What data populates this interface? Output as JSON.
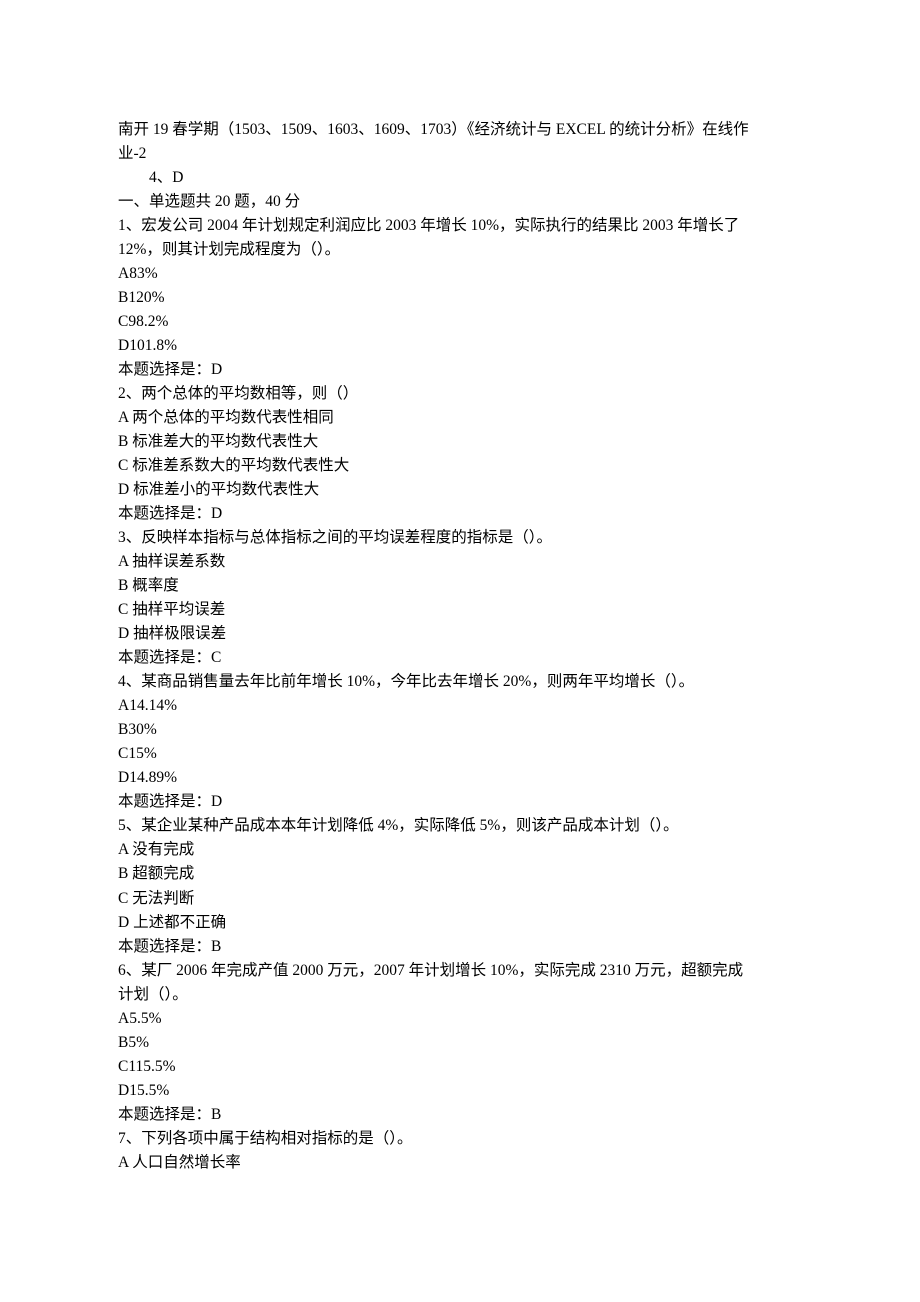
{
  "header": {
    "title_line1": "南开 19 春学期（1503、1509、1603、1609、1703）《经济统计与 EXCEL 的统计分析》在线作",
    "title_line2": "业-2",
    "note": "4、D"
  },
  "section1": {
    "heading": "一、单选题共 20 题，40 分"
  },
  "q1": {
    "stem_line1": "1、宏发公司 2004 年计划规定利润应比 2003 年增长 10%，实际执行的结果比 2003 年增长了",
    "stem_line2": "12%，则其计划完成程度为（）。",
    "optA": "A83%",
    "optB": "B120%",
    "optC": "C98.2%",
    "optD": "D101.8%",
    "answer": "本题选择是：D"
  },
  "q2": {
    "stem": "2、两个总体的平均数相等，则（）",
    "optA": "A 两个总体的平均数代表性相同",
    "optB": "B 标准差大的平均数代表性大",
    "optC": "C 标准差系数大的平均数代表性大",
    "optD": "D 标准差小的平均数代表性大",
    "answer": "本题选择是：D"
  },
  "q3": {
    "stem": "3、反映样本指标与总体指标之间的平均误差程度的指标是（）。",
    "optA": "A 抽样误差系数",
    "optB": "B 概率度",
    "optC": "C 抽样平均误差",
    "optD": "D 抽样极限误差",
    "answer": "本题选择是：C"
  },
  "q4": {
    "stem": "4、某商品销售量去年比前年增长 10%，今年比去年增长 20%，则两年平均增长（）。",
    "optA": "A14.14%",
    "optB": "B30%",
    "optC": "C15%",
    "optD": "D14.89%",
    "answer": "本题选择是：D"
  },
  "q5": {
    "stem": "5、某企业某种产品成本本年计划降低 4%，实际降低 5%，则该产品成本计划（）。",
    "optA": "A 没有完成",
    "optB": "B 超额完成",
    "optC": "C 无法判断",
    "optD": "D 上述都不正确",
    "answer": "本题选择是：B"
  },
  "q6": {
    "stem_line1": "6、某厂 2006 年完成产值 2000 万元，2007 年计划增长 10%，实际完成 2310 万元，超额完成",
    "stem_line2": "计划（）。",
    "optA": "A5.5%",
    "optB": "B5%",
    "optC": "C115.5%",
    "optD": "D15.5%",
    "answer": "本题选择是：B"
  },
  "q7": {
    "stem": "7、下列各项中属于结构相对指标的是（）。",
    "optA": "A 人口自然增长率"
  }
}
